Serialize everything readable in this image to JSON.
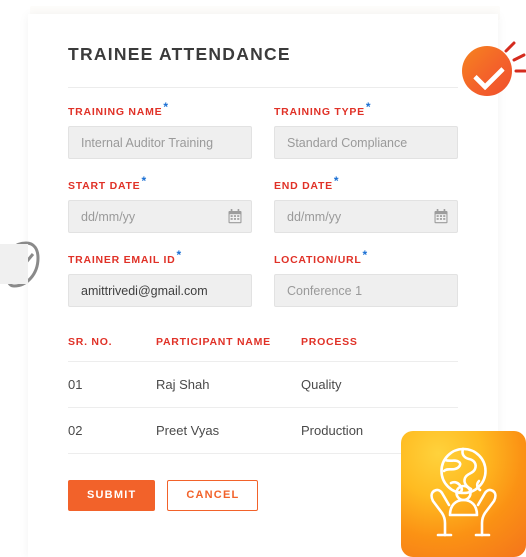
{
  "page": {
    "title": "TRAINEE ATTENDANCE"
  },
  "form": {
    "fields": [
      {
        "label": "TRAINING NAME",
        "required_marker": "*",
        "value": "",
        "placeholder": "Internal Auditor Training",
        "type": "text"
      },
      {
        "label": "TRAINING TYPE",
        "required_marker": "*",
        "value": "",
        "placeholder": "Standard Compliance",
        "type": "text"
      },
      {
        "label": "START DATE",
        "required_marker": "*",
        "value": "",
        "placeholder": "dd/mm/yy",
        "type": "date",
        "icon": "calendar-icon"
      },
      {
        "label": "END DATE",
        "required_marker": "*",
        "value": "",
        "placeholder": "dd/mm/yy",
        "type": "date",
        "icon": "calendar-icon"
      },
      {
        "label": "TRAINER EMAIL ID",
        "required_marker": "*",
        "value": "amittrivedi@gmail.com",
        "placeholder": "",
        "type": "email"
      },
      {
        "label": "LOCATION/URL",
        "required_marker": "*",
        "value": "",
        "placeholder": "Conference 1",
        "type": "text"
      }
    ]
  },
  "participants_table": {
    "columns": [
      "SR. NO.",
      "PARTICIPANT NAME",
      "PROCESS"
    ],
    "rows": [
      {
        "sr_no": "01",
        "name": "Raj Shah",
        "process": "Quality"
      },
      {
        "sr_no": "02",
        "name": "Preet Vyas",
        "process": "Production"
      }
    ]
  },
  "actions": {
    "submit_label": "SUBMIT",
    "cancel_label": "CANCEL"
  },
  "colors": {
    "label_red": "#e03127",
    "required_blue": "#1a6fd4",
    "accent_orange": "#f2622a",
    "input_fill": "#efefef",
    "title_grey": "#3b3b3b",
    "badge_orange": "#f6841f",
    "burst_red": "#d42b1e",
    "tile_yellow": "#ffd23c",
    "leaf_grey": "#8a8a8a"
  },
  "decorations": [
    {
      "name": "leaf-icon",
      "description": "leaf outline with diagonal vein"
    },
    {
      "name": "check-badge-icon",
      "description": "orange circle with white check and red burst lines"
    },
    {
      "name": "globe-in-hands-icon",
      "description": "orange gradient tile with globe, person and cupping hands"
    }
  ]
}
